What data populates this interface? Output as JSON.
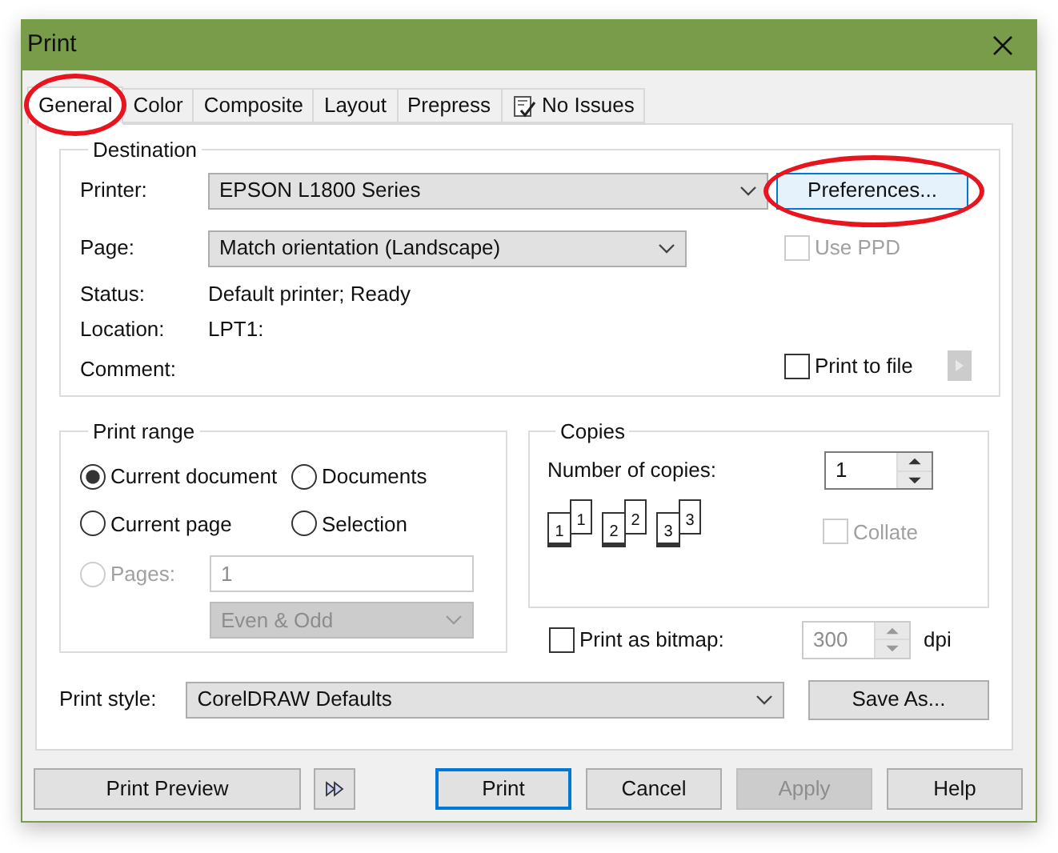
{
  "window": {
    "title": "Print"
  },
  "tabs": [
    {
      "label": "General",
      "selected": true,
      "highlighted": true,
      "kind": "text"
    },
    {
      "label": "Color",
      "selected": false,
      "highlighted": false,
      "kind": "text"
    },
    {
      "label": "Composite",
      "selected": false,
      "highlighted": false,
      "kind": "text"
    },
    {
      "label": "Layout",
      "selected": false,
      "highlighted": false,
      "kind": "text"
    },
    {
      "label": "Prepress",
      "selected": false,
      "highlighted": false,
      "kind": "text"
    },
    {
      "label": "No Issues",
      "selected": false,
      "highlighted": false,
      "kind": "icon"
    }
  ],
  "destination": {
    "title": "Destination",
    "printer": {
      "label": "Printer:",
      "value": "EPSON L1800 Series"
    },
    "preferences": {
      "label": "Preferences...",
      "highlighted": true
    },
    "page": {
      "label": "Page:",
      "value": "Match orientation (Landscape)"
    },
    "use_ppd": {
      "label": "Use PPD",
      "checked": false,
      "disabled": true
    },
    "status": {
      "label": "Status:",
      "value": "Default printer; Ready"
    },
    "location": {
      "label": "Location:",
      "value": "LPT1:"
    },
    "comment": {
      "label": "Comment:"
    },
    "print_to_file": {
      "label": "Print to file",
      "checked": false
    }
  },
  "print_range": {
    "title": "Print range",
    "options": [
      {
        "label": "Current document",
        "selected": true,
        "disabled": false
      },
      {
        "label": "Documents",
        "selected": false,
        "disabled": false
      },
      {
        "label": "Current page",
        "selected": false,
        "disabled": false
      },
      {
        "label": "Selection",
        "selected": false,
        "disabled": false
      },
      {
        "label": "Pages:",
        "selected": false,
        "disabled": true
      }
    ],
    "pages_value": "1",
    "page_filter": "Even & Odd"
  },
  "copies": {
    "title": "Copies",
    "label": "Number of copies:",
    "value": "1",
    "collate_preview": [
      {
        "front": "1",
        "back": "1"
      },
      {
        "front": "2",
        "back": "2"
      },
      {
        "front": "3",
        "back": "3"
      }
    ],
    "collate": {
      "label": "Collate",
      "checked": false,
      "disabled": true
    }
  },
  "bitmap": {
    "label": "Print as bitmap:",
    "checked": false,
    "value": "300",
    "unit": "dpi"
  },
  "print_style": {
    "label": "Print style:",
    "value": "CorelDRAW Defaults",
    "save_as": "Save As..."
  },
  "print_preview": "Print Preview",
  "buttons": [
    {
      "label": "Print",
      "default": true,
      "disabled": false
    },
    {
      "label": "Cancel",
      "default": false,
      "disabled": false
    },
    {
      "label": "Apply",
      "default": false,
      "disabled": true
    },
    {
      "label": "Help",
      "default": false,
      "disabled": false
    }
  ]
}
